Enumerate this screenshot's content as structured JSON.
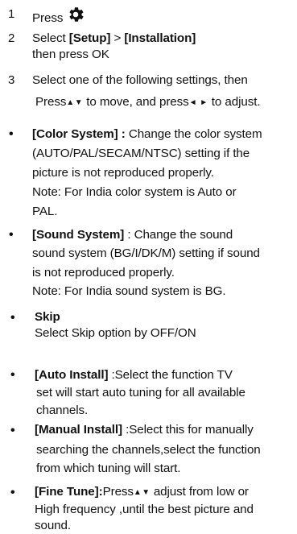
{
  "steps": [
    {
      "num": "1",
      "text": "Press"
    },
    {
      "num": "2",
      "text_a": "Select ",
      "bold_a": "[Setup]",
      "text_b": " > ",
      "bold_b": "[Installation]",
      "line2": "then press OK"
    },
    {
      "num": "3",
      "line1": "Select one of the following settings, then",
      "line2_a": "Press",
      "line2_b": " to move, and press",
      "line2_c": " to adjust."
    }
  ],
  "icons": {
    "settings": "gear-icon",
    "up_down": "▲▼",
    "left_right": "◄ ►"
  },
  "bullets": {
    "symbol": "•",
    "color_system": {
      "title": "[Color System] :",
      "l1": " Change the color system",
      "l2": "(AUTO/PAL/SECAM/NTSC) setting if the",
      "l3": "picture is not reproduced properly.",
      "l4": "Note: For India color system is Auto or",
      "l5": "PAL."
    },
    "sound_system": {
      "title": "[Sound System]",
      "l1": "  : Change the sound",
      "l2": "sound system (BG/I/DK/M) setting if sound",
      "l3": "is not reproduced properly.",
      "l4": "Note: For India sound system is BG."
    },
    "skip": {
      "title": "Skip",
      "l1": "Select  Skip option by OFF/ON"
    },
    "auto_install": {
      "title": "[Auto Install]",
      "l1": " :Select the function TV",
      "l2": "set will start auto tuning for all available",
      "l3": "channels."
    },
    "manual_install": {
      "title": "[Manual Install]",
      "l1": "  :Select this for manually",
      "l2": "searching the channels,select the function",
      "l3": "from which tuning will start."
    },
    "fine_tune": {
      "title": "[Fine Tune]:",
      "l1_a": "Press",
      "l1_b": " adjust from low or",
      "l2": "High frequency ,until the  best picture and",
      "l3": "sound."
    }
  }
}
